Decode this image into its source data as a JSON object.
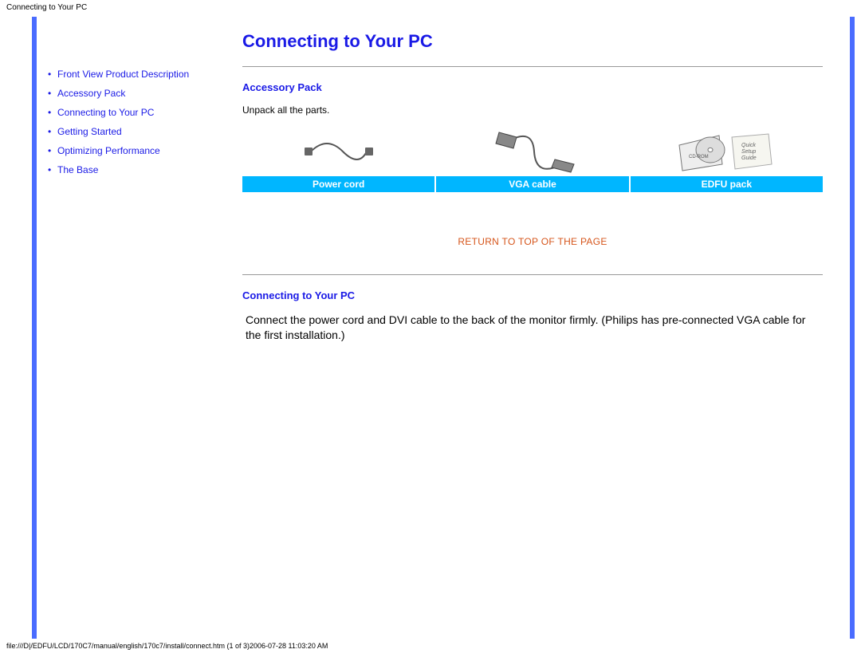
{
  "top_label": "Connecting to Your PC",
  "title": "Connecting to Your PC",
  "sidebar": {
    "items": [
      {
        "label": "Front View Product Description"
      },
      {
        "label": "Accessory Pack"
      },
      {
        "label": "Connecting to Your PC"
      },
      {
        "label": "Getting Started"
      },
      {
        "label": "Optimizing Performance"
      },
      {
        "label": "The Base"
      }
    ]
  },
  "section1": {
    "heading": "Accessory Pack",
    "text": "Unpack all the parts.",
    "labels": [
      "Power cord",
      "VGA cable",
      "EDFU pack"
    ]
  },
  "return_link": "RETURN TO TOP OF THE PAGE",
  "section2": {
    "heading": "Connecting to Your PC",
    "paragraph": "Connect the power cord and DVI cable to the back of the monitor firmly. (Philips has pre-connected VGA cable for the first installation.)"
  },
  "footer": "file:///D|/EDFU/LCD/170C7/manual/english/170c7/install/connect.htm (1 of 3)2006-07-28 11:03:20 AM"
}
